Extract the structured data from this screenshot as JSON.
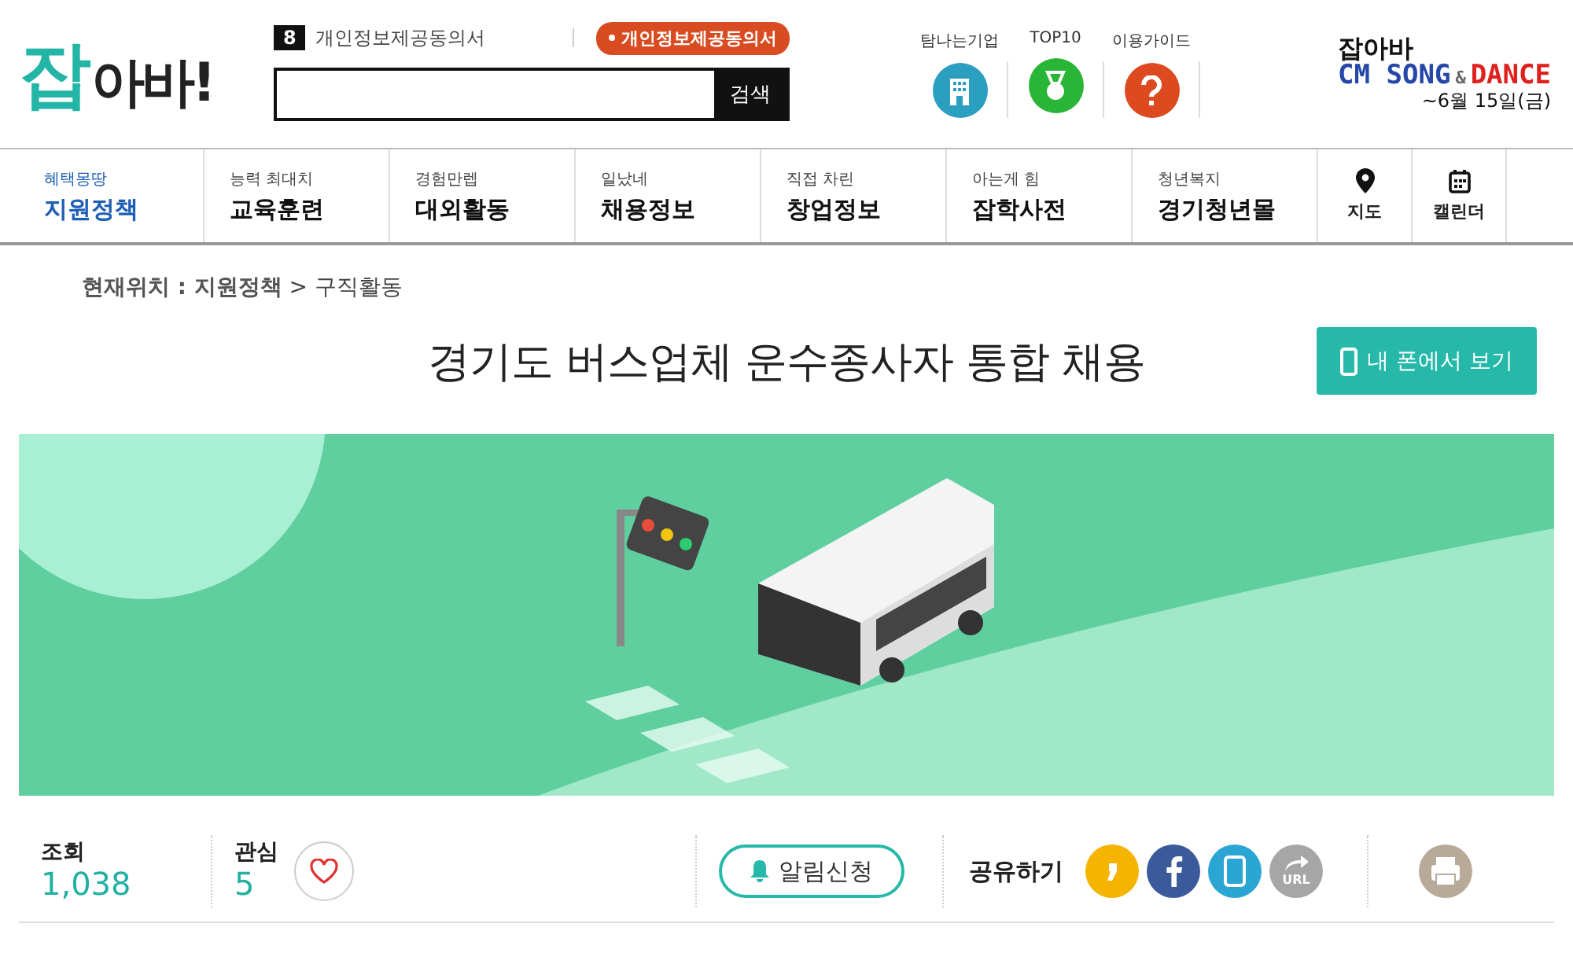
{
  "header": {
    "logo": {
      "first": "잡",
      "rest": "아바!"
    },
    "notice": {
      "count": "8",
      "text": "개인정보제공동의서"
    },
    "consent_badge": "개인정보제공동의서",
    "search": {
      "button": "검색"
    },
    "quick_links": [
      {
        "label": "탐나는기업",
        "kind": "building",
        "color": "#2a9fbf"
      },
      {
        "label": "TOP10",
        "kind": "medal",
        "color": "#29b536"
      },
      {
        "label": "이용가이드",
        "kind": "question",
        "color": "#dd4a1f"
      }
    ],
    "promo": {
      "title": "잡아바",
      "song": "CM SONG",
      "amp": "&",
      "dance": "DANCE",
      "date": "~6월 15일(금)"
    }
  },
  "nav": {
    "items": [
      {
        "sub": "혜택몽땅",
        "label": "지원정책",
        "selected": true
      },
      {
        "sub": "능력 최대치",
        "label": "교육훈련",
        "selected": false
      },
      {
        "sub": "경험만렙",
        "label": "대외활동",
        "selected": false
      },
      {
        "sub": "일났네",
        "label": "채용정보",
        "selected": false
      },
      {
        "sub": "직접 차린",
        "label": "창업정보",
        "selected": false
      },
      {
        "sub": "아는게 힘",
        "label": "잡학사전",
        "selected": false
      },
      {
        "sub": "청년복지",
        "label": "경기청년몰",
        "selected": false
      }
    ],
    "tools": [
      {
        "label": "지도",
        "kind": "map"
      },
      {
        "label": "캘린더",
        "kind": "calendar"
      }
    ]
  },
  "breadcrumb": "**현재위치 : 지원정책** > 구직활동",
  "title": "경기도 버스업체 운수종사자 통합 채용",
  "mobile_button": "내 폰에서 보기",
  "stats": {
    "views": {
      "label": "조회",
      "value": "1,038"
    },
    "likes": {
      "label": "관심",
      "value": "5"
    },
    "alert_button": "알림신청",
    "share_label": "공유하기",
    "share": [
      {
        "kind": "kakao"
      },
      {
        "kind": "facebook"
      },
      {
        "kind": "phone"
      },
      {
        "kind": "url",
        "text": "URL"
      }
    ]
  }
}
